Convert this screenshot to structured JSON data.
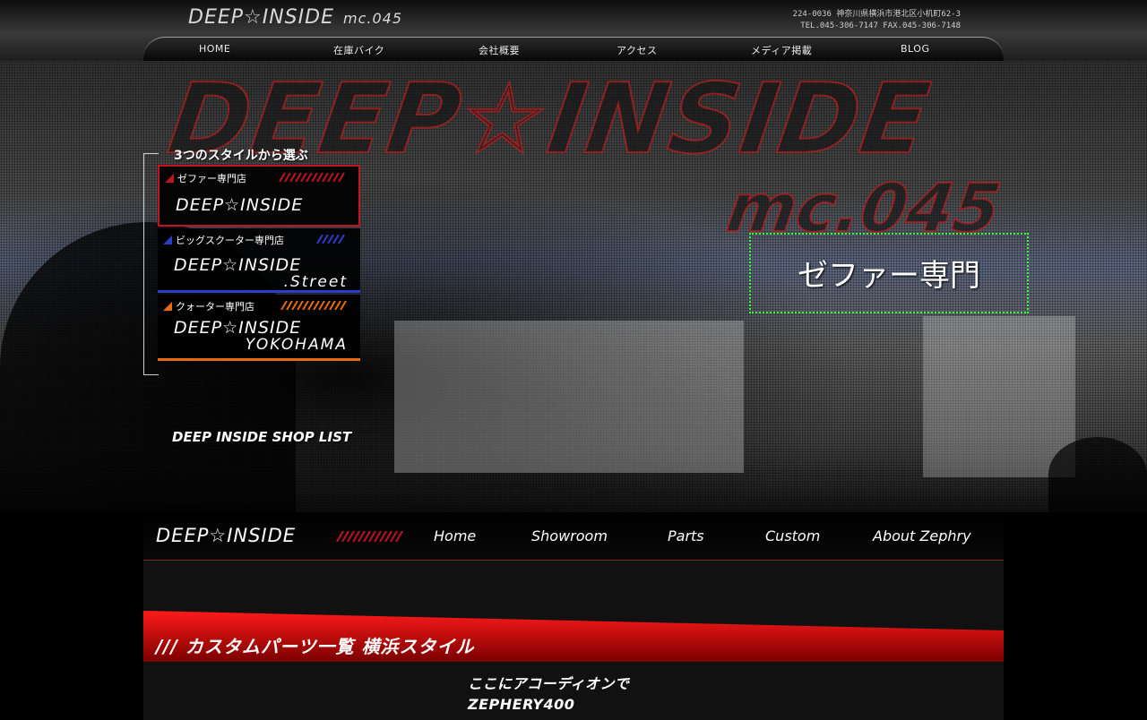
{
  "header": {
    "logo": "DEEP☆INSIDE",
    "logo_suffix": "mc.045",
    "address": "224-0036 神奈川県横浜市港北区小机町62-3",
    "tel_fax": "TEL.045-306-7147 FAX.045-306-7148"
  },
  "top_nav": [
    "HOME",
    "在庫バイク",
    "会社概要",
    "アクセス",
    "メディア掲載",
    "BLOG"
  ],
  "hero": {
    "title": "DEEP☆INSIDE",
    "subtitle": "mc.045",
    "zephyr_label": "ゼファー専門"
  },
  "style_selector": {
    "heading": "3つのスタイルから選ぶ",
    "shops": [
      {
        "label": "ゼファー専門店",
        "name": "DEEP☆INSIDE",
        "name2": "",
        "accent": "#c0141e"
      },
      {
        "label": "ビッグスクーター専門店",
        "name": "DEEP☆INSIDE",
        "name2": ".Street",
        "accent": "#2a3ec8"
      },
      {
        "label": "クォーター専門店",
        "name": "DEEP☆INSIDE",
        "name2": "YOKOHAMA",
        "accent": "#e86a10"
      }
    ],
    "shop_list_link": "DEEP INSIDE SHOP LIST"
  },
  "sub_nav": {
    "logo": "DEEP☆INSIDE",
    "items": [
      "Home",
      "Showroom",
      "Parts",
      "Custom",
      "About Zephry"
    ]
  },
  "banner": {
    "title": "/// カスタムパーツ一覧 横浜スタイル"
  },
  "accordion_note": {
    "line1": "ここにアコーディオンで",
    "line2": "ZEPHERY400"
  }
}
